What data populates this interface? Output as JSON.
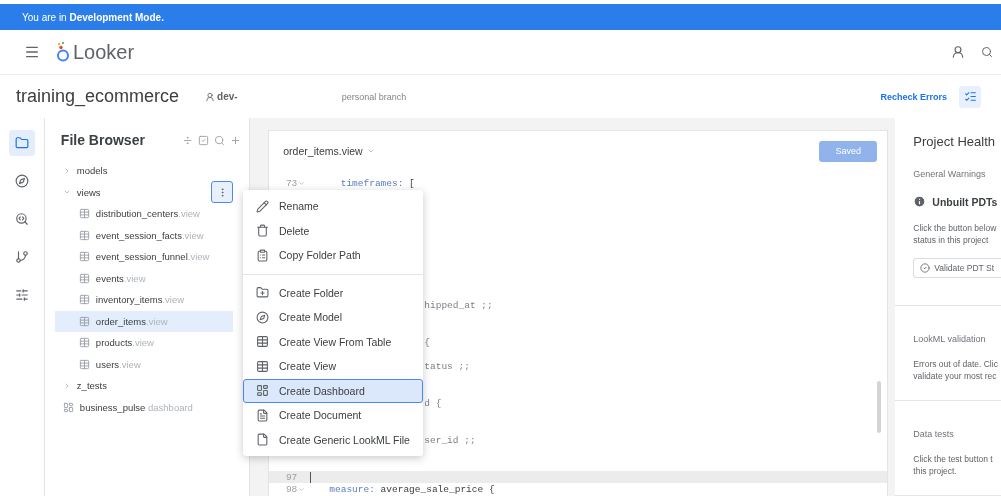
{
  "banner": {
    "text": "You are in **Development Mode.**"
  },
  "header": {
    "logo": "Looker"
  },
  "project_bar": {
    "title": "training_ecommerce",
    "branch_user": "dev-",
    "branch_label": "personal branch",
    "recheck": "Recheck Errors"
  },
  "rail": [
    {
      "selected": true
    },
    {
      "selected": false
    },
    {
      "selected": false
    },
    {
      "selected": false
    },
    {
      "selected": false
    }
  ],
  "file_browser": {
    "title": "File Browser",
    "tree": [
      {
        "name": "models",
        "kind": "folder",
        "expanded": false,
        "selected": false
      },
      {
        "name": "views",
        "kind": "folder",
        "expanded": true,
        "selected": false,
        "children": [
          {
            "name": "distribution_centers",
            "ext": ".view",
            "kind": "view",
            "selected": false
          },
          {
            "name": "event_session_facts",
            "ext": ".view",
            "kind": "view",
            "selected": false
          },
          {
            "name": "event_session_funnel",
            "ext": ".view",
            "kind": "view",
            "selected": false
          },
          {
            "name": "events",
            "ext": ".view",
            "kind": "view",
            "selected": false
          },
          {
            "name": "inventory_items",
            "ext": ".view",
            "kind": "view",
            "selected": false
          },
          {
            "name": "order_items",
            "ext": ".view",
            "kind": "view",
            "selected": true
          },
          {
            "name": "products",
            "ext": ".view",
            "kind": "view",
            "selected": false
          },
          {
            "name": "users",
            "ext": ".view",
            "kind": "view",
            "selected": false
          }
        ]
      },
      {
        "name": "z_tests",
        "kind": "folder",
        "expanded": false,
        "selected": false
      },
      {
        "name": "business_pulse",
        "ext": " dashboard",
        "kind": "dashboard",
        "selected": false
      }
    ]
  },
  "context_menu": {
    "groups": [
      [
        {
          "label": "Rename",
          "selected": false
        },
        {
          "label": "Delete",
          "selected": false
        },
        {
          "label": "Copy Folder Path",
          "selected": false
        }
      ],
      [
        {
          "label": "Create Folder",
          "selected": false
        },
        {
          "label": "Create Model",
          "selected": false
        },
        {
          "label": "Create View From Table",
          "selected": false
        },
        {
          "label": "Create View",
          "selected": false
        },
        {
          "label": "Create Dashboard",
          "selected": true
        },
        {
          "label": "Create Document",
          "selected": false
        },
        {
          "label": "Create Generic LookML File",
          "selected": false
        }
      ]
    ]
  },
  "editor": {
    "file": "order_items.view",
    "save": {
      "label": "Saved",
      "disabled": true
    },
    "lines": [
      {
        "kind": "full",
        "number": "73",
        "fold": true,
        "key": "  timeframes:",
        "code": " [",
        "active": false
      },
      {
        "kind": "partial",
        "code": "hipped_at ;;",
        "active": false
      },
      {
        "kind": "partial",
        "code": "{",
        "active": false
      },
      {
        "kind": "partial",
        "code": "tatus ;;",
        "active": false
      },
      {
        "kind": "partial",
        "code": "d {",
        "active": false
      },
      {
        "kind": "partial",
        "code": "ser_id ;;",
        "active": false
      },
      {
        "kind": "full",
        "number": "97",
        "fold": false,
        "active": true
      },
      {
        "kind": "full",
        "number": "98",
        "fold": true,
        "key": "measure:",
        "code": " average_sale_price {",
        "active": false
      }
    ]
  },
  "project_health": {
    "title": "Project Health",
    "sections": [
      {
        "heading": "General Warnings",
        "warning": "Unbuilt PDTs",
        "text": [
          "Click the button below",
          "status in this project"
        ],
        "button": "Validate PDT St"
      },
      {
        "heading": "LookML validation",
        "text": [
          "Errors out of date. Clic",
          "validate your most rec"
        ]
      },
      {
        "heading": "Data tests",
        "text": [
          "Click the test button t",
          "this project."
        ]
      }
    ]
  }
}
